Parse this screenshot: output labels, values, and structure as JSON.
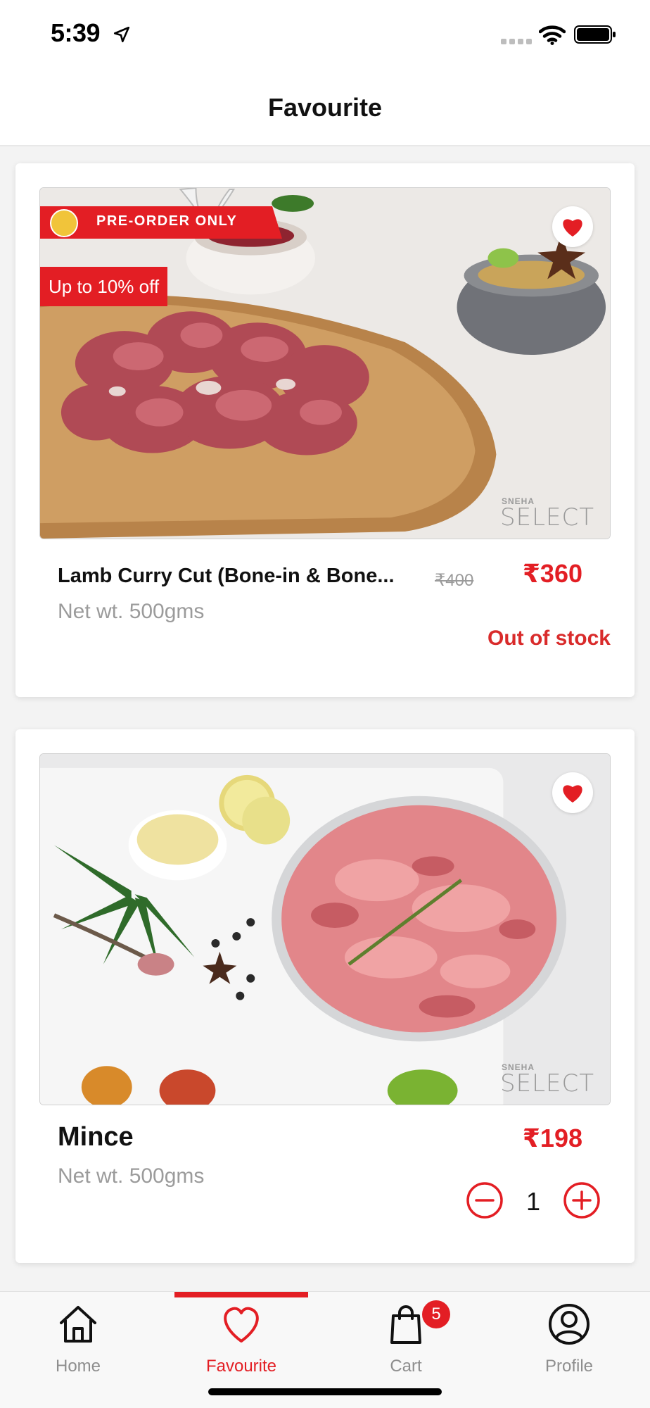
{
  "status_bar": {
    "time": "5:39"
  },
  "header": {
    "title": "Favourite"
  },
  "products": [
    {
      "name": "Lamb Curry Cut (Bone-in & Bone...",
      "net_weight": "Net wt. 500gms",
      "mrp": "₹400",
      "price": "₹360",
      "stock_status": "Out of stock",
      "ribbon": "PRE-ORDER ONLY",
      "discount": "Up to 10% off",
      "watermark_small": "SNEHA",
      "watermark_big": "SELECT",
      "favourited": true
    },
    {
      "name": "Mince",
      "net_weight": "Net wt. 500gms",
      "price": "₹198",
      "quantity": "1",
      "watermark_small": "SNEHA",
      "watermark_big": "SELECT",
      "favourited": true
    }
  ],
  "tabbar": {
    "items": [
      {
        "label": "Home",
        "icon": "home-icon"
      },
      {
        "label": "Favourite",
        "icon": "heart-icon",
        "active": true
      },
      {
        "label": "Cart",
        "icon": "shopping-bag-icon",
        "badge": "5"
      },
      {
        "label": "Profile",
        "icon": "user-circle-icon"
      }
    ]
  },
  "colors": {
    "accent": "#e31e24",
    "muted": "#9b9b9b",
    "text": "#111111"
  }
}
